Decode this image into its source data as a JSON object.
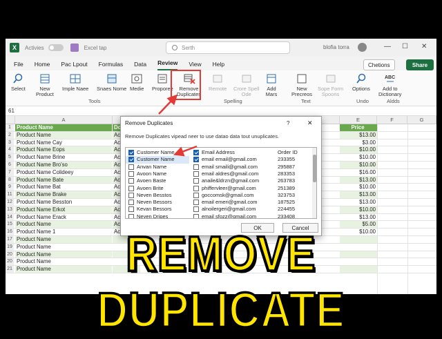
{
  "titlebar": {
    "autosave": "Activies",
    "filename": "Excel tap",
    "search_placeholder": "Serth",
    "user": "blofia torra",
    "min": "—",
    "max": "☐",
    "close": "✕"
  },
  "tabs": [
    "File",
    "Home",
    "Pac Lpout",
    "Formulas",
    "Data",
    "Review",
    "View",
    "Help"
  ],
  "active_tab": "Review",
  "top_buttons": {
    "chetions": "Chetions",
    "share": "Share"
  },
  "ribbon": {
    "buttons": [
      {
        "label": "Select",
        "sub": ""
      },
      {
        "label": "New",
        "sub": "Product"
      },
      {
        "label": "Imple Naee",
        "sub": ""
      },
      {
        "label": "Snaes Nome",
        "sub": ""
      },
      {
        "label": "Medie",
        "sub": ""
      },
      {
        "label": "Proporee",
        "sub": ""
      },
      {
        "label": "Remove",
        "sub": "Duplicates"
      },
      {
        "label": "Remote",
        "sub": ""
      },
      {
        "label": "Crore Spell",
        "sub": "Ode"
      },
      {
        "label": "Add",
        "sub": "Mars"
      },
      {
        "label": "New",
        "sub": "Precreos"
      },
      {
        "label": "Sope Form",
        "sub": "Spoons"
      },
      {
        "label": "Options",
        "sub": ""
      },
      {
        "label": "Add to",
        "sub": "Dictionary"
      }
    ],
    "groups": [
      "Tools",
      "Spelling",
      "Text",
      "Undo",
      "Aldds"
    ]
  },
  "formula_bar": {
    "namebox": "61"
  },
  "grid": {
    "columns": [
      "A",
      "B",
      "E",
      "F",
      "G"
    ],
    "header": {
      "a": "Product Name",
      "b": "Dote",
      "e": "Price"
    },
    "rows": [
      {
        "n": "1",
        "a": "Product Name",
        "b": "Dote",
        "e": "Price"
      },
      {
        "n": "2",
        "a": "Product Name",
        "b": "Acc",
        "e": "$13.00"
      },
      {
        "n": "3",
        "a": "Product Name Cay",
        "b": "Acc",
        "e": "$3.00"
      },
      {
        "n": "4",
        "a": "Product Name Eops",
        "b": "Acc",
        "e": "$10.00"
      },
      {
        "n": "5",
        "a": "Product Name Brine",
        "b": "Acc",
        "e": "$10.00"
      },
      {
        "n": "6",
        "a": "Product Name Bro'so",
        "b": "Acc",
        "e": "$10.00"
      },
      {
        "n": "7",
        "a": "Product Name Colideey",
        "b": "Acc",
        "e": "$16.00"
      },
      {
        "n": "8",
        "a": "Product Name Bate",
        "b": "Acc",
        "e": "$13.00"
      },
      {
        "n": "9",
        "a": "Product Name Bat",
        "b": "Acc",
        "e": "$10.00"
      },
      {
        "n": "11",
        "a": "Product Name Brake",
        "b": "Acc",
        "e": "$13.00"
      },
      {
        "n": "12",
        "a": "Product Name Besston",
        "b": "Acc",
        "e": "$13.00"
      },
      {
        "n": "13",
        "a": "Product Name Erkot",
        "b": "Acc",
        "e": "$10.00"
      },
      {
        "n": "14",
        "a": "Product Name Erack",
        "b": "Acc",
        "e": "$13.00"
      },
      {
        "n": "15",
        "a": "Product Name",
        "b": "Acc",
        "e": "$5.00"
      },
      {
        "n": "16",
        "a": "Product Name 1",
        "b": "Acc",
        "e": "$10.00"
      },
      {
        "n": "17",
        "a": "Product Name",
        "b": "",
        "e": ""
      },
      {
        "n": "19",
        "a": "Product Name",
        "b": "",
        "e": ""
      },
      {
        "n": "20",
        "a": "Product Name",
        "b": "",
        "e": ""
      },
      {
        "n": "20",
        "a": "Product Name",
        "b": "",
        "e": ""
      },
      {
        "n": "21",
        "a": "Product Name",
        "b": "",
        "e": ""
      }
    ]
  },
  "dialog": {
    "title": "Remove Duplicates",
    "help": "?",
    "close": "✕",
    "description": "Remove Duplicates vipead neer to use datao data tout unuplicates.",
    "rows": [
      {
        "c1": "Customer Name",
        "c1on": true,
        "c2": "Email Address",
        "c2on": true,
        "c3": "Order ID"
      },
      {
        "c1": "Customer Name",
        "c1on": true,
        "c2": "email email@gmail.com",
        "c2on": true,
        "c3": "233355"
      },
      {
        "c1": "Anvan Name",
        "c1on": false,
        "c2": "email smaili@gmail.com",
        "c2on": false,
        "c3": "295887"
      },
      {
        "c1": "Avoon Name",
        "c1on": false,
        "c2": "email aldres@gmail.com",
        "c2on": false,
        "c3": "283353"
      },
      {
        "c1": "Avoen Baste",
        "c1on": false,
        "c2": "anaile&ldrzn@gmail.com",
        "c2on": false,
        "c3": "263783"
      },
      {
        "c1": "Avoen Brite",
        "c1on": false,
        "c2": "phiffervleer@gmail.com",
        "c2on": false,
        "c3": "251389"
      },
      {
        "c1": "Neven Besstos",
        "c1on": false,
        "c2": "goccomsk@gmail.com",
        "c2on": false,
        "c3": "323753"
      },
      {
        "c1": "Neven Bessors",
        "c1on": false,
        "c2": "email emeri@gmail.com",
        "c2on": false,
        "c3": "187525"
      },
      {
        "c1": "Kevan Bessors",
        "c1on": false,
        "c2": "alnoilergeri@gmail.com",
        "c2on": false,
        "c3": "224455"
      },
      {
        "c1": "Neven Dripes",
        "c1on": false,
        "c2": "email sfozz@gmail.com",
        "c2on": false,
        "c3": "233408"
      }
    ],
    "ok": "OK",
    "cancel": "Cancel"
  },
  "overlay_title": "REMOVE DUPLICATE",
  "colors": {
    "excel_green": "#1d6f42",
    "header_green": "#6aa84f",
    "arrow_red": "#e53935",
    "title_yellow": "#ffe500"
  }
}
